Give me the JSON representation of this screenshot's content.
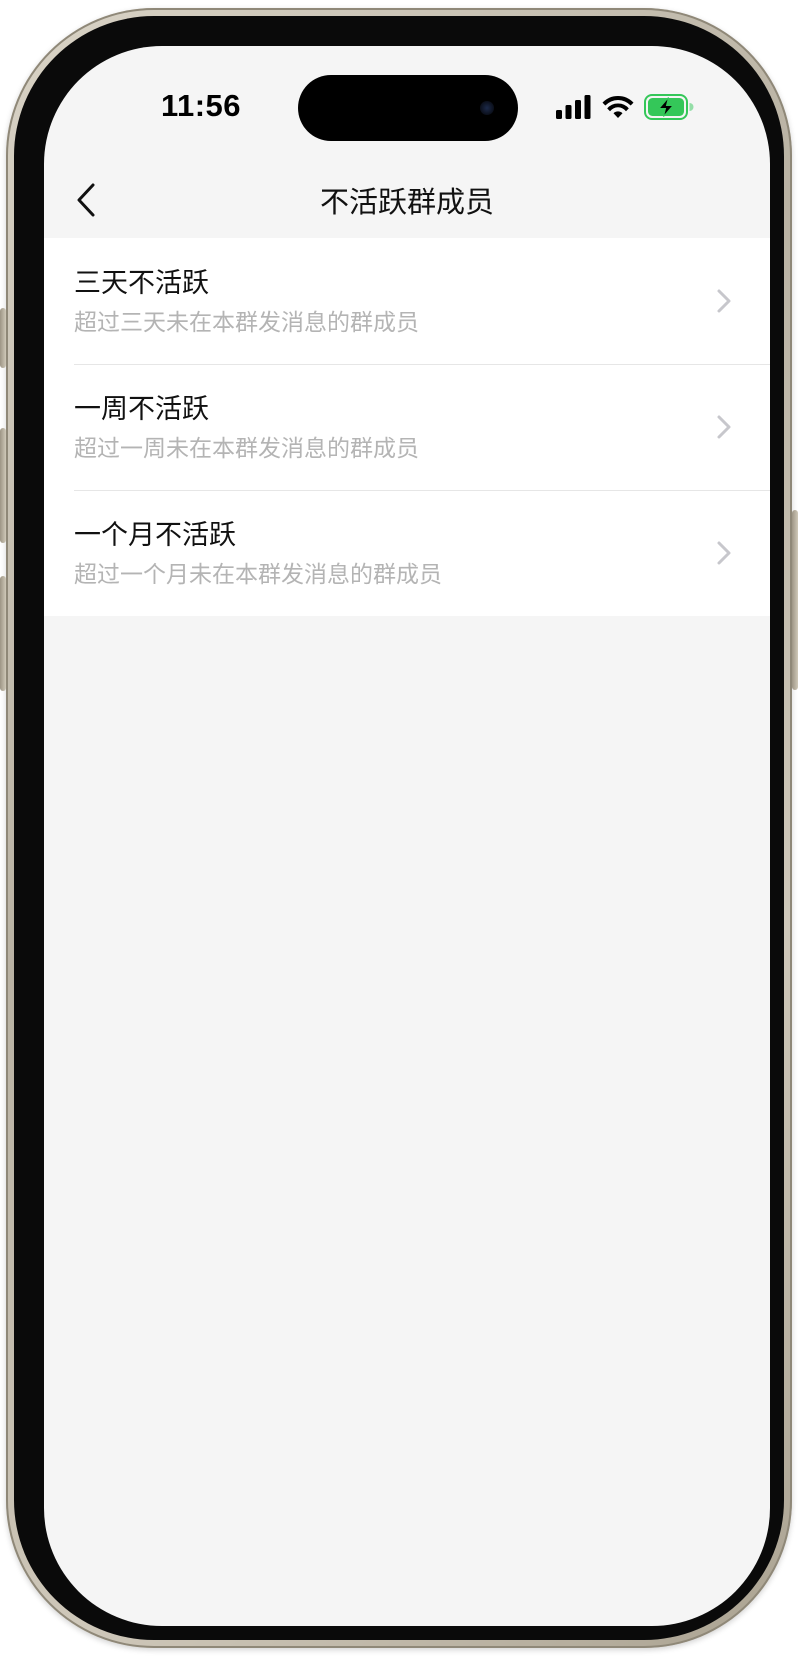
{
  "status_bar": {
    "time": "11:56",
    "signal_icon": "cellular-signal-icon",
    "wifi_icon": "wifi-icon",
    "battery_icon": "battery-charging-icon",
    "battery_color": "#34c759"
  },
  "nav": {
    "back_icon": "chevron-left-icon",
    "title": "不活跃群成员"
  },
  "options": [
    {
      "title": "三天不活跃",
      "subtitle": "超过三天未在本群发消息的群成员",
      "icon": "chevron-right-icon"
    },
    {
      "title": "一周不活跃",
      "subtitle": "超过一周未在本群发消息的群成员",
      "icon": "chevron-right-icon"
    },
    {
      "title": "一个月不活跃",
      "subtitle": "超过一个月未在本群发消息的群成员",
      "icon": "chevron-right-icon"
    }
  ],
  "colors": {
    "background": "#f5f5f5",
    "list_background": "#ffffff",
    "subtitle": "#b4b4b4",
    "chevron": "#c7c7cc"
  }
}
